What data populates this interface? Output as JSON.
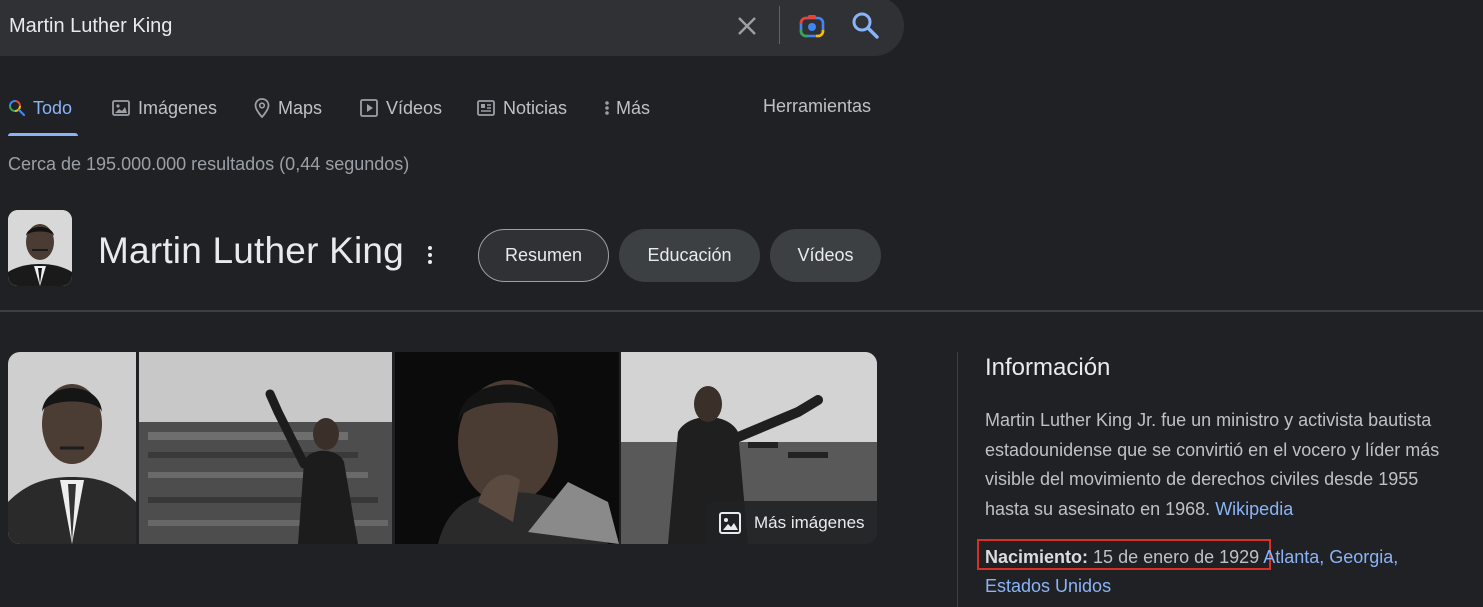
{
  "search": {
    "query": "Martin Luther King"
  },
  "tabs": [
    {
      "label": "Todo",
      "icon": "search-icon"
    },
    {
      "label": "Imágenes",
      "icon": "image-icon"
    },
    {
      "label": "Maps",
      "icon": "map-pin-icon"
    },
    {
      "label": "Vídeos",
      "icon": "play-icon"
    },
    {
      "label": "Noticias",
      "icon": "news-icon"
    },
    {
      "label": "Más",
      "icon": "more-vertical-icon"
    }
  ],
  "tools_label": "Herramientas",
  "results_stats": "Cerca de 195.000.000 resultados (0,44 segundos)",
  "entity": {
    "title": "Martin Luther King",
    "chips": [
      "Resumen",
      "Educación",
      "Vídeos"
    ]
  },
  "gallery": {
    "more_label": "Más imágenes"
  },
  "info": {
    "title": "Información",
    "description": "Martin Luther King Jr. fue un ministro y activista bautista estadounidense que se convirtió en el vocero y líder más visible del movimiento de derechos civiles desde 1955 hasta su asesinato en 1968.",
    "source_link": "Wikipedia",
    "birth_label": "Nacimiento:",
    "birth_date": "15 de enero de 1929",
    "birth_place": "Atlanta, Georgia, Estados Unidos"
  },
  "colors": {
    "background": "#202124",
    "accent": "#8ab4f8",
    "highlight_box": "#d93025"
  }
}
